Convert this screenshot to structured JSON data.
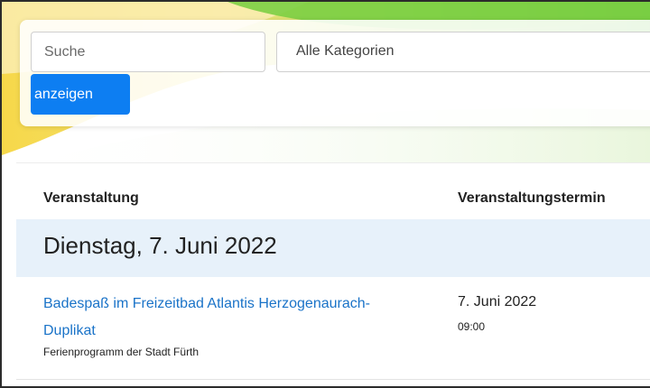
{
  "search": {
    "placeholder": "Suche",
    "category_selected": "Alle Kategorien",
    "button_label": "anzeigen"
  },
  "table": {
    "headers": [
      "Veranstaltung",
      "Veranstaltungstermin"
    ],
    "day_heading": "Dienstag, 7. Juni 2022",
    "events": [
      {
        "title": "Badespaß im Freizeitbad Atlantis Herzogenaurach-Duplikat",
        "organizer": "Ferienprogramm der Stadt Fürth",
        "date": "7. Juni 2022",
        "time": "09:00"
      }
    ]
  },
  "colors": {
    "accent": "#0d7ef2",
    "link": "#1a73c8",
    "day_band": "#e7f1fa",
    "background_green": "#8ccf4f",
    "background_yellow": "#f5d23a"
  }
}
